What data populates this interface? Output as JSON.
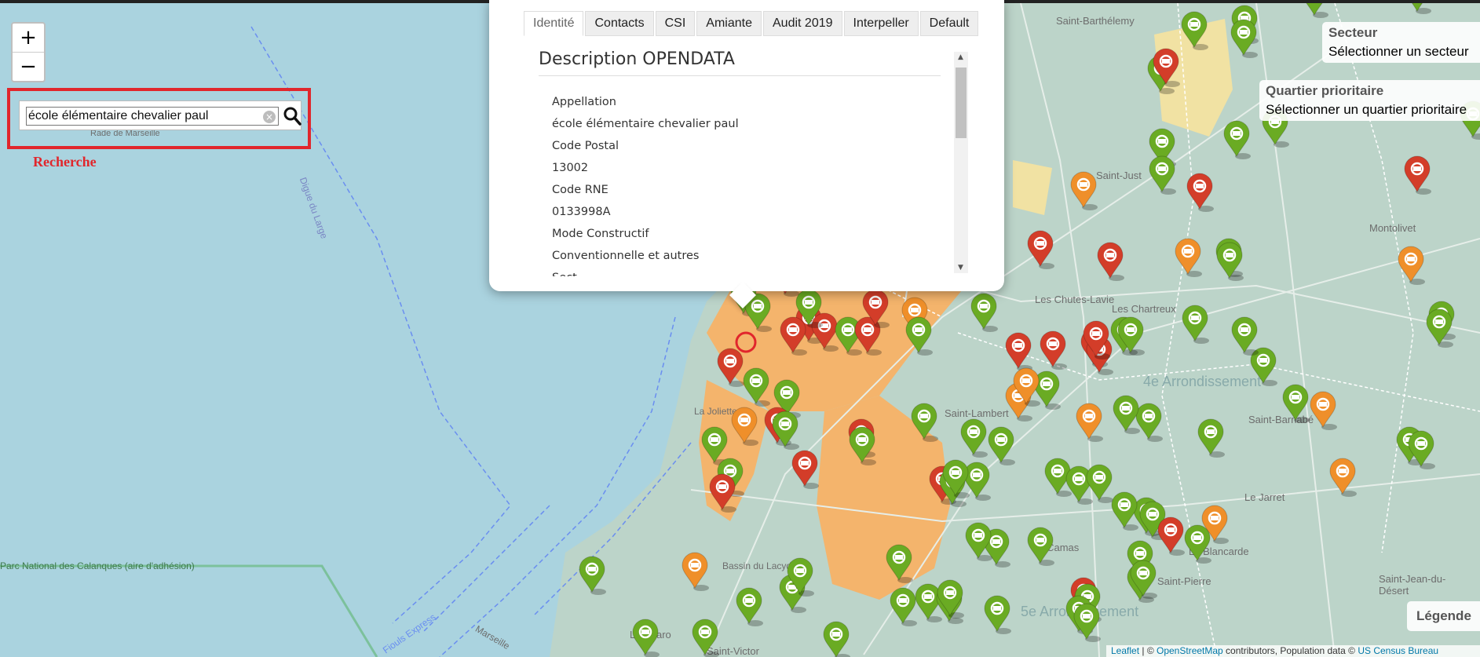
{
  "zoom": {
    "in_label": "+",
    "out_label": "−"
  },
  "search": {
    "value": "école élémentaire chevalier paul",
    "caption": "Recherche",
    "icon": "search-icon"
  },
  "popup": {
    "tabs": [
      "Identité",
      "Contacts",
      "CSI",
      "Amiante",
      "Audit 2019",
      "Interpeller",
      "Default"
    ],
    "active_tab": "Identité",
    "section_title": "Description OPENDATA",
    "fields": [
      {
        "label": "Appellation",
        "value": "école élémentaire chevalier paul"
      },
      {
        "label": "Code Postal",
        "value": "13002"
      },
      {
        "label": "Code RNE",
        "value": "0133998A"
      },
      {
        "label": "Mode Constructif",
        "value": "Conventionnelle et autres"
      }
    ],
    "cut_line": "Sect"
  },
  "secteur": {
    "title": "Secteur",
    "value": "Sélectionner un secteur"
  },
  "quartier": {
    "title": "Quartier prioritaire",
    "value": "Sélectionner un quartier prioritaire"
  },
  "legend": {
    "label": "Légende"
  },
  "attribution": {
    "leaflet": "Leaflet",
    "sep": " | © ",
    "osm": "OpenStreetMap",
    "mid": " contributors, Population data © ",
    "census": "US Census Bureau"
  },
  "map_labels": [
    "Rade de Marseille",
    "Digue du Large",
    "Parc National des Calanques (aire d'adhésion)",
    "Fiouls Express",
    "Marseille",
    "Saint-Barthélemy",
    "Saint-Just",
    "Montolivet",
    "Les Chutes-Lavie",
    "Les Chartreux",
    "4e Arrondissement",
    "Saint-Barnabé",
    "La Blancarde",
    "Saint-Pierre",
    "Le Pharo",
    "Saint-Victor",
    "Saint-Jean-du-Désert",
    "5e Arrondissement",
    "Le Camas",
    "La Joliette",
    "Saint-Lambert",
    "Le Jarret",
    "Bassin du Lacydon"
  ],
  "marker_colors": {
    "green": "#6aab23",
    "red": "#d33d29",
    "orange": "#ef8f2a"
  },
  "area_colors": {
    "sector": "#f4b46c",
    "priority": "#f1e2a3",
    "land": "#bcd4c9",
    "sea": "#aad3df"
  }
}
